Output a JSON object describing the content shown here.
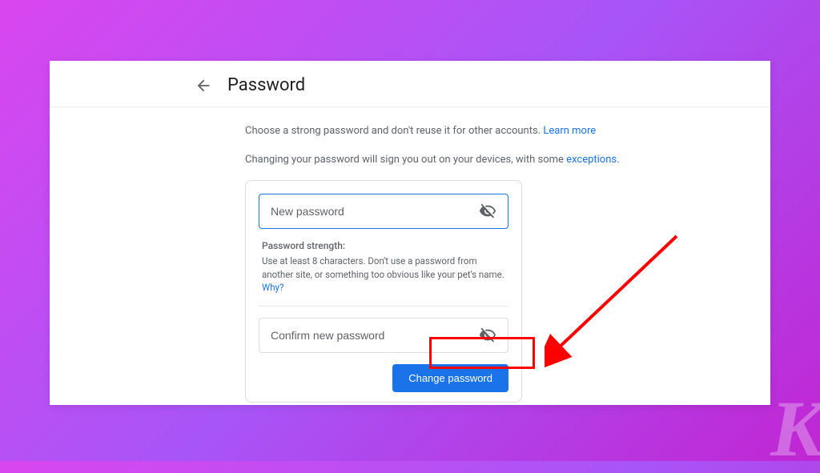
{
  "header": {
    "title": "Password"
  },
  "intro": {
    "line1_text": "Choose a strong password and don't reuse it for other accounts. ",
    "line1_link": "Learn more",
    "line2_text_a": "Changing your password will sign you out on your devices, with some ",
    "line2_link": "exceptions",
    "line2_text_b": "."
  },
  "form": {
    "new_password_placeholder": "New password",
    "confirm_password_placeholder": "Confirm new password",
    "strength_label": "Password strength:",
    "strength_text": "Use at least 8 characters. Don't use a password from another site, or something too obvious like your pet's name. ",
    "strength_link": "Why?",
    "submit_label": "Change password"
  }
}
